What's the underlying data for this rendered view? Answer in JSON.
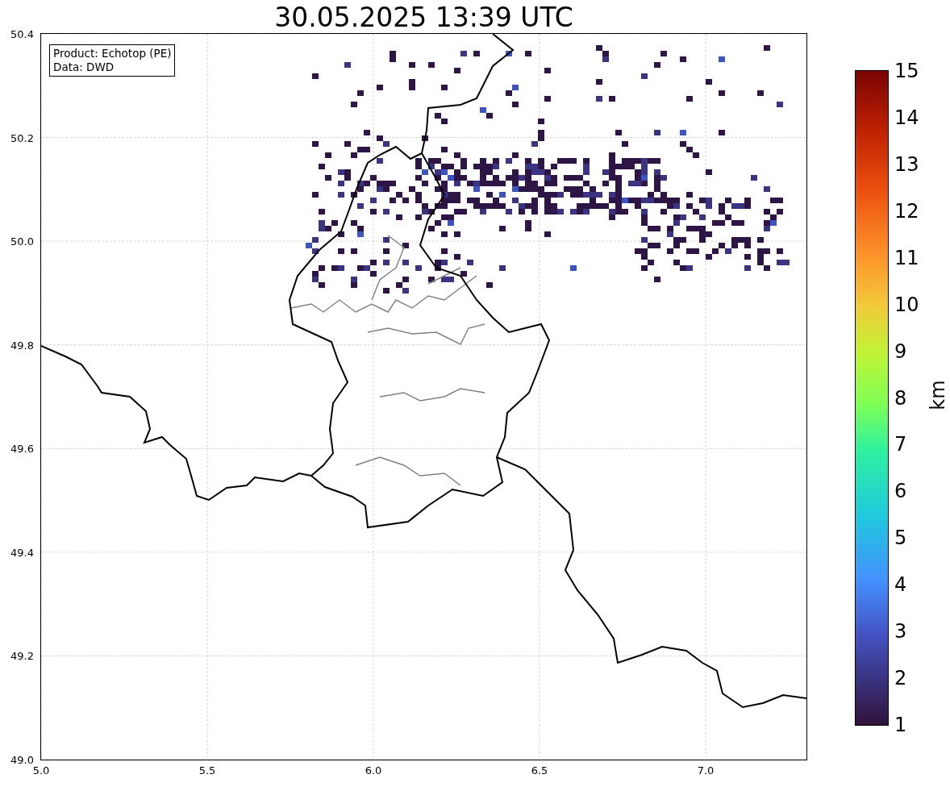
{
  "title": "30.05.2025 13:39 UTC",
  "map": {
    "legend": [
      "Product: Echotop (PE)",
      "Data: DWD"
    ],
    "x_ticks": [
      "5.0",
      "5.5",
      "6.0",
      "6.5",
      "7.0"
    ],
    "y_ticks": [
      "50.4",
      "50.2",
      "50.0",
      "49.8",
      "49.6",
      "49.4",
      "49.2",
      "49.0"
    ]
  },
  "colorbar": {
    "label": "km",
    "ticks": [
      "15",
      "14",
      "13",
      "12",
      "11",
      "10",
      "9",
      "8",
      "7",
      "6",
      "5",
      "4",
      "3",
      "2",
      "1"
    ]
  }
}
